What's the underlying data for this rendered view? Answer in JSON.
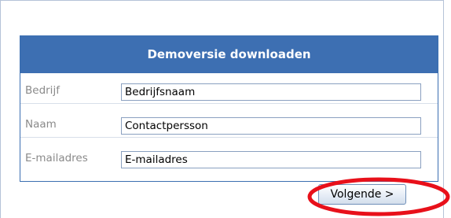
{
  "form": {
    "title": "Demoversie downloaden",
    "fields": [
      {
        "label": "Bedrijf",
        "value": "Bedrijfsnaam"
      },
      {
        "label": "Naam",
        "value": "Contactpersson"
      },
      {
        "label": "E-mailadres",
        "value": "E-mailadres"
      }
    ],
    "next_label": "Volgende >"
  },
  "colors": {
    "header_bg": "#3d6fb2",
    "highlight_ellipse": "#e8101a"
  }
}
